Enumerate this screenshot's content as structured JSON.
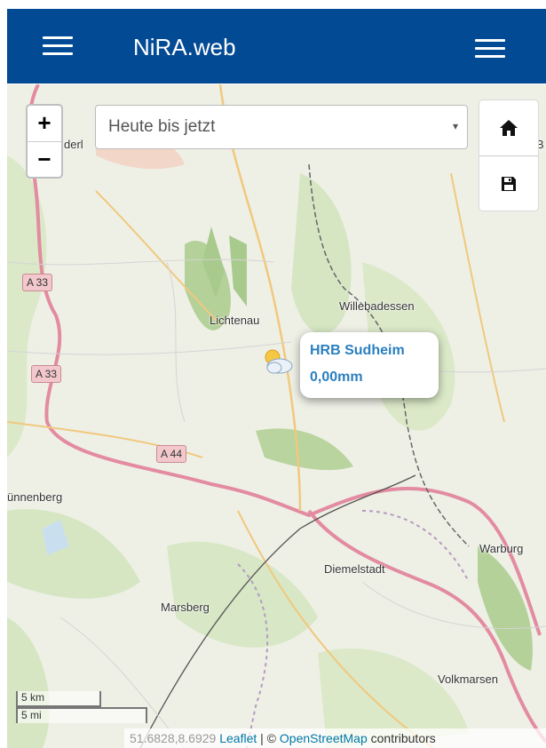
{
  "app": {
    "title": "NiRA.web"
  },
  "header": {
    "left_menu_icon": "hamburger-icon",
    "right_menu_icon": "hamburger-icon"
  },
  "zoom": {
    "in_label": "+",
    "out_label": "−"
  },
  "period_select": {
    "value": "Heute bis jetzt",
    "arrow": "▾"
  },
  "side_buttons": {
    "home_icon": "home-icon",
    "save_icon": "floppy-disk-icon"
  },
  "station": {
    "name": "HRB Sudheim",
    "value": "0,00mm",
    "icon": "sun-cloud-icon"
  },
  "map_labels": {
    "lichtenau": "Lichtenau",
    "willebadessen": "Willebadessen",
    "fuerstenberg": "ünnenberg",
    "diemelstadt": "Diemelstadt",
    "marsberg": "Marsberg",
    "warburg": "Warburg",
    "volkmarsen": "Volkmarsen",
    "paderborn": "derl",
    "b_partial": "B"
  },
  "road_shields": {
    "a33_top": "A 33",
    "a33_mid": "A 33",
    "a44": "A 44"
  },
  "scale": {
    "km": "5 km",
    "mi": "5 mi"
  },
  "attribution": {
    "coords": "51.6828,8.6929",
    "leaflet": "Leaflet",
    "sep": " | © ",
    "osm": "OpenStreetMap",
    "contributors": " contributors"
  }
}
